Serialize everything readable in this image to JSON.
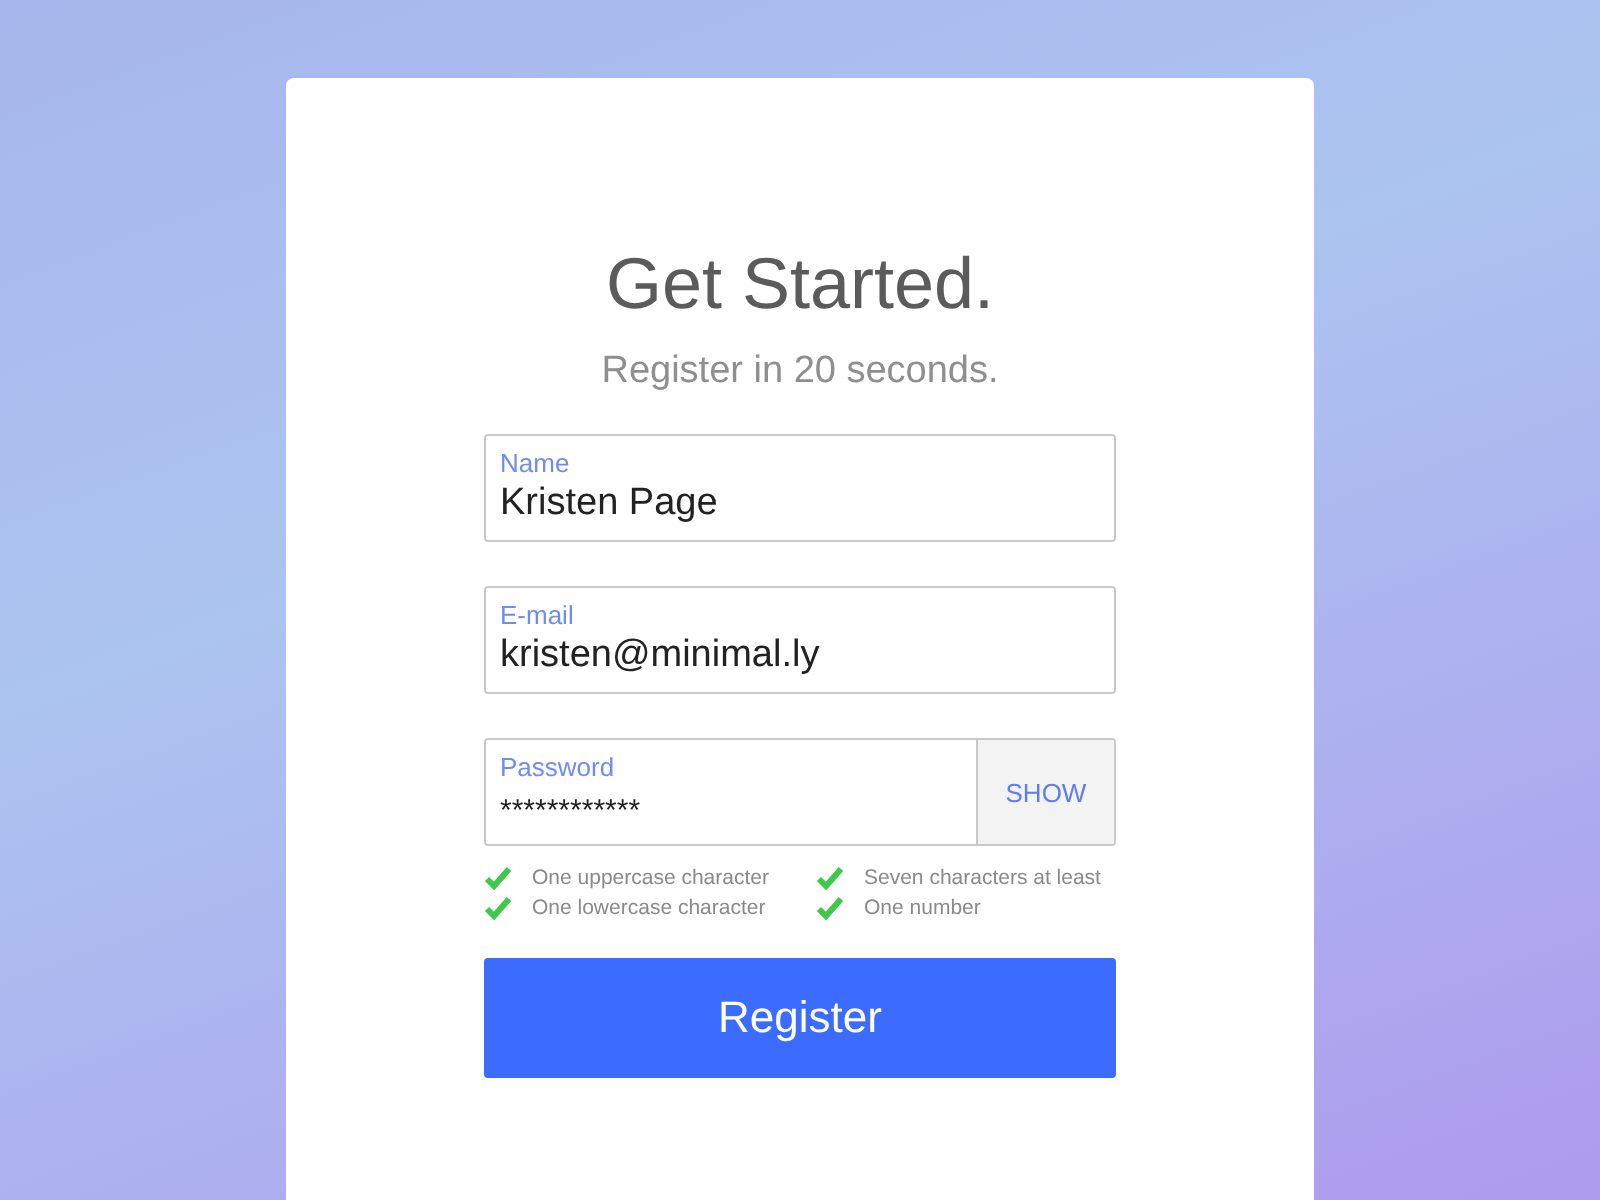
{
  "title": "Get Started.",
  "subtitle": "Register in 20 seconds.",
  "fields": [
    {
      "kind": "text",
      "label": "Name",
      "value": "Kristen Page"
    },
    {
      "kind": "text",
      "label": "E-mail",
      "value": "kristen@minimal.ly"
    },
    {
      "kind": "password",
      "label": "Password",
      "value": "************",
      "toggle": "SHOW"
    }
  ],
  "rules": [
    {
      "text": "One uppercase character",
      "met": true
    },
    {
      "text": "Seven characters at least",
      "met": true
    },
    {
      "text": "One lowercase character",
      "met": true
    },
    {
      "text": "One number",
      "met": true
    }
  ],
  "button": "Register"
}
